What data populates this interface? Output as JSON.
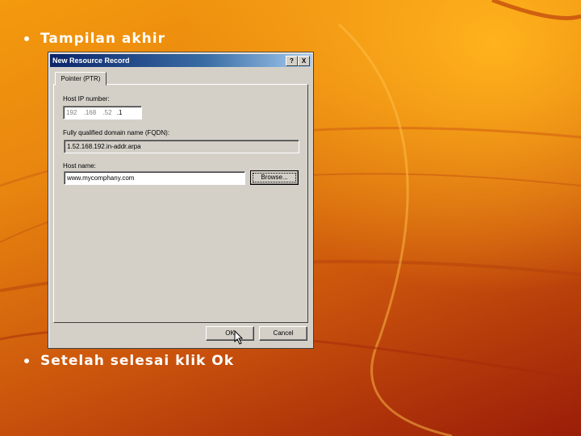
{
  "slide": {
    "bullet_1": "Tampilan akhir",
    "bullet_2": "Setelah selesai klik Ok"
  },
  "dialog": {
    "title": "New Resource Record",
    "help_btn": "?",
    "close_btn": "X",
    "tab_label": "Pointer (PTR)",
    "host_ip_label": "Host IP number:",
    "ip_octets": [
      "192",
      ".168",
      ".52",
      ".1"
    ],
    "fqdn_label": "Fully qualified domain name (FQDN):",
    "fqdn_value": "1.52.168.192.in-addr.arpa",
    "host_name_label": "Host name:",
    "host_name_value": "www.mycomphany.com",
    "browse_btn": "Browse...",
    "ok_btn": "OK",
    "cancel_btn": "Cancel"
  },
  "colors": {
    "titlebar_start": "#0a246a",
    "titlebar_end": "#a6caf0",
    "dialog_face": "#d4d0c8"
  }
}
